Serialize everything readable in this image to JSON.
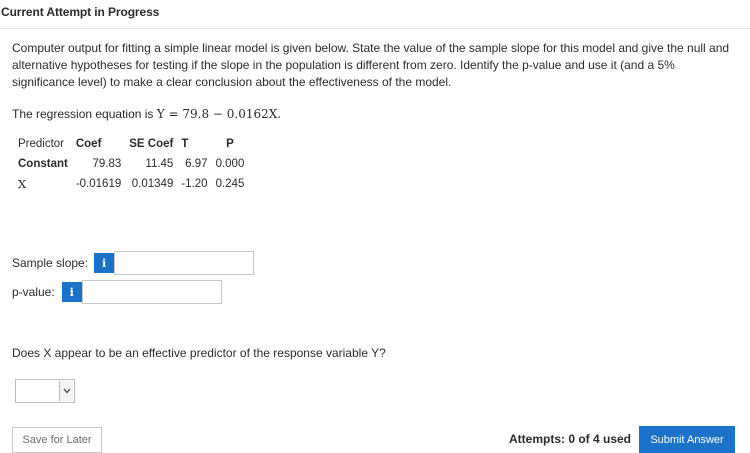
{
  "header": {
    "title": "Current Attempt in Progress"
  },
  "question": {
    "text": "Computer output for fitting a simple linear model is given below. State the value of the sample slope for this model and give the null and alternative hypotheses for testing if the slope in the population is different from zero. Identify the p-value and use it (and a 5% significance level) to make a clear conclusion about the effectiveness of the model.",
    "equation_prefix": "The regression equation is ",
    "equation": "Y = 79.8 − 0.0162X."
  },
  "regression_table": {
    "headers": [
      "Predictor",
      "Coef",
      "SE Coef",
      "T",
      "P"
    ],
    "rows": [
      [
        "Constant",
        "79.83",
        "11.45",
        "6.97",
        "0.000"
      ],
      [
        "X",
        "-0.01619",
        "0.01349",
        "-1.20",
        "0.245"
      ]
    ]
  },
  "fields": {
    "slope_label": "Sample slope:",
    "slope_value": "",
    "pvalue_label": "p-value:",
    "pvalue_value": "",
    "info_glyph": "i"
  },
  "question2": {
    "text": "Does X appear to be an effective predictor of the response variable Y?"
  },
  "dropdown": {
    "selected": ""
  },
  "footer": {
    "save_label": "Save for Later",
    "attempts_text": "Attempts: 0 of 4 used",
    "submit_label": "Submit Answer"
  },
  "colors": {
    "accent": "#1a73c9"
  },
  "icons": {
    "info": "info-icon",
    "dropdown": "chevron-down-icon"
  }
}
